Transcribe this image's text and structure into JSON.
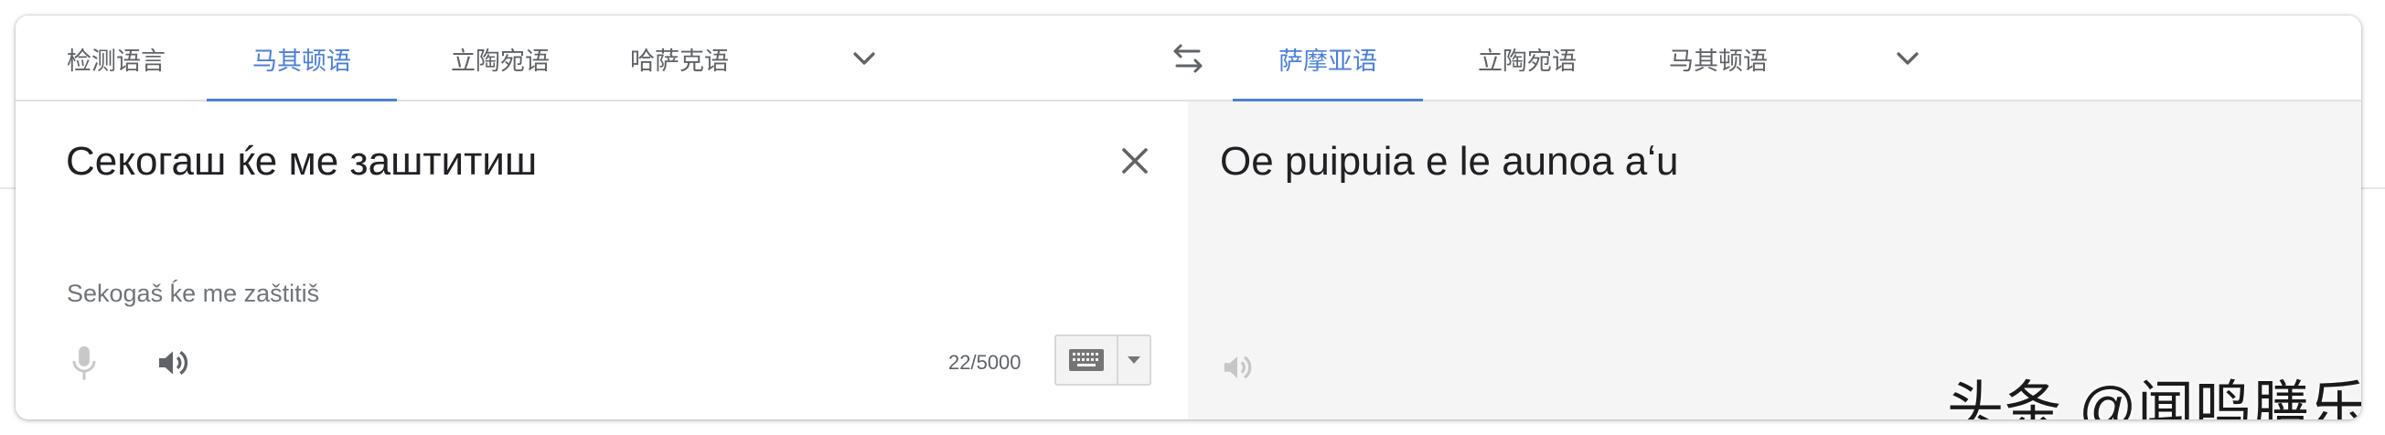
{
  "source_tabs": [
    {
      "label": "检测语言",
      "active": false
    },
    {
      "label": "马其顿语",
      "active": true
    },
    {
      "label": "立陶宛语",
      "active": false
    },
    {
      "label": "哈萨克语",
      "active": false
    }
  ],
  "target_tabs": [
    {
      "label": "萨摩亚语",
      "active": true
    },
    {
      "label": "立陶宛语",
      "active": false
    },
    {
      "label": "马其顿语",
      "active": false
    }
  ],
  "source": {
    "text": "Секогаш ќе ме заштитиш",
    "transliteration": "Sekogaš ḱe me zaštitiš",
    "char_count": "22/5000"
  },
  "target": {
    "text": "Oe puipuia e le aunoa aʻu"
  },
  "watermark": "头条 @闻鸣膳乐",
  "colors": {
    "accent": "#4d7fd6",
    "text": "#202124",
    "muted": "#5f6368",
    "target_bg": "#f5f5f5"
  },
  "icons": [
    "chevron-down-icon",
    "swap-languages-icon",
    "close-icon",
    "microphone-icon",
    "speaker-icon",
    "keyboard-icon",
    "dropdown-arrow-icon"
  ]
}
